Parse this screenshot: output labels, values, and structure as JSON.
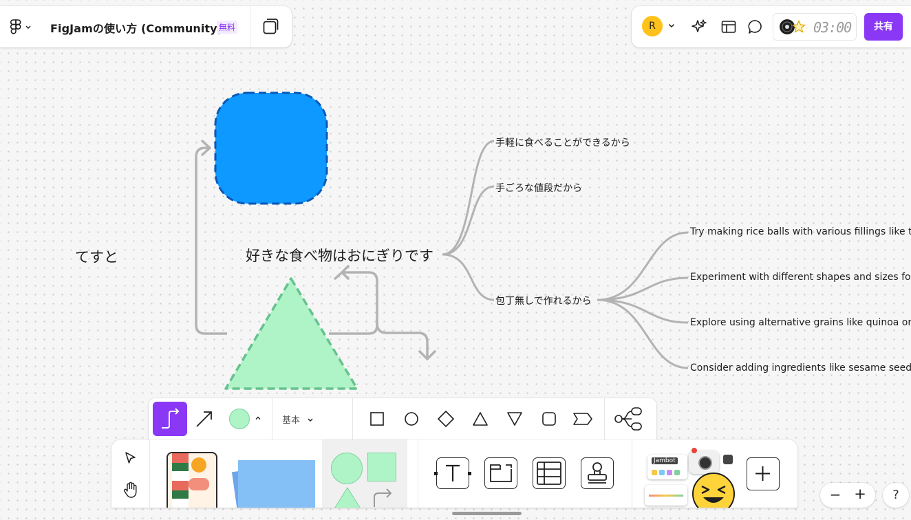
{
  "file": {
    "title": "FigJamの使い方 (Community)",
    "plan_badge": "無料"
  },
  "header_right": {
    "avatar_initial": "R",
    "timer": "03:00",
    "share_label": "共有"
  },
  "canvas": {
    "free_text": "てすと",
    "mindmap": {
      "central": "好きな食べ物はおにぎりです",
      "branches": [
        "手軽に食べることができるから",
        "手ごろな値段だから",
        "包丁無しで作れるから"
      ],
      "sub_branches": [
        "Try making rice balls with various fillings like tu",
        "Experiment with different shapes and sizes for",
        "Explore using alternative grains like quinoa or b",
        "Consider adding ingredients like sesame seeds"
      ]
    },
    "colors": {
      "rounded_square_fill": "#0d99ff",
      "rounded_square_stroke": "#0a58b8",
      "triangle_fill": "#aff4c6",
      "triangle_stroke": "#66c28f",
      "connector": "#b3b3b3"
    }
  },
  "shape_bar": {
    "style_label": "基本",
    "fill_color": "#aff4c6",
    "accent": "#8a38f5"
  },
  "toolbar": {
    "sticker_label": "Jambot"
  },
  "zoom": {
    "minus": "−",
    "plus": "+"
  },
  "help_label": "?"
}
